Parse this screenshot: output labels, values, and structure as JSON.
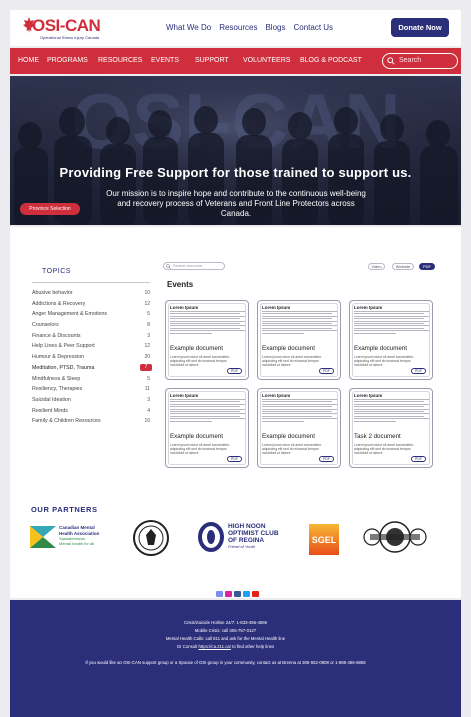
{
  "header": {
    "logo": {
      "word": "OSI-CAN",
      "tagline": "Operational Stress Injury Canada"
    },
    "topnav": [
      "What We Do",
      "Resources",
      "Blogs",
      "Contact Us"
    ],
    "donate": "Donate Now"
  },
  "mainnav": {
    "items": [
      "HOME",
      "PROGRAMS",
      "RESOURCES",
      "EVENTS",
      "SUPPORT",
      "VOLUNTEERS",
      "BLOG & PODCAST"
    ],
    "search_placeholder": "Search"
  },
  "hero": {
    "title": "Providing Free Support for those trained to support us.",
    "subtitle": "Our mission is to inspire hope and contribute to the continuous well-being and recovery process of Veterans and Front Line Protectors across Canada.",
    "province_button": "Province Selection",
    "backdrop_word": "OSI-CAN"
  },
  "topics": {
    "heading": "TOPICS",
    "items": [
      {
        "label": "Abusive behavior",
        "count": "10"
      },
      {
        "label": "Addictions & Recovery",
        "count": "12"
      },
      {
        "label": "Anger Management & Emotions",
        "count": "5"
      },
      {
        "label": "Counselors",
        "count": "8"
      },
      {
        "label": "Finance & Discounts",
        "count": "3"
      },
      {
        "label": "Help Lines & Peer Support",
        "count": "12"
      },
      {
        "label": "Humour & Depression",
        "count": "20"
      },
      {
        "label": "Meditation, PTSD, Trauma",
        "count": "7",
        "active": true
      },
      {
        "label": "Mindfulness & Sleep",
        "count": "5"
      },
      {
        "label": "Resiliency, Therapies",
        "count": "11"
      },
      {
        "label": "Suicidal Ideation",
        "count": "3"
      },
      {
        "label": "Resilient Minds",
        "count": "4"
      },
      {
        "label": "Family & Children Resources",
        "count": "16"
      }
    ]
  },
  "events": {
    "search_placeholder": "Search resource",
    "filters": [
      "Video",
      "Website",
      "PDF"
    ],
    "active_filter": "PDF",
    "heading": "Events",
    "cards": [
      {
        "heading": "Lorem Ipsum",
        "title": "Example document",
        "desc": "Lorem ipsum dolor sit amet consectetur adipiscing elit sed do eiusmod tempor incididunt ut labore",
        "tag": "PDF"
      },
      {
        "heading": "Lorem Ipsum",
        "title": "Example document",
        "desc": "Lorem ipsum dolor sit amet consectetur adipiscing elit sed do eiusmod tempor incididunt ut labore",
        "tag": "PDF"
      },
      {
        "heading": "Lorem Ipsum",
        "title": "Example document",
        "desc": "Lorem ipsum dolor sit amet consectetur adipiscing elit sed do eiusmod tempor incididunt ut labore",
        "tag": "PDF"
      },
      {
        "heading": "Lorem Ipsum",
        "title": "Example document",
        "desc": "Lorem ipsum dolor sit amet consectetur adipiscing elit sed do eiusmod tempor incididunt ut labore",
        "tag": "PDF"
      },
      {
        "heading": "Lorem Ipsum",
        "title": "Example document",
        "desc": "Lorem ipsum dolor sit amet consectetur adipiscing elit sed do eiusmod tempor incididunt ut labore",
        "tag": "PDF"
      },
      {
        "heading": "Lorem Ipsum",
        "title": "Task 2 document",
        "desc": "Lorem ipsum dolor sit amet consectetur adipiscing elit sed do eiusmod tempor incididunt ut labore",
        "tag": "PDF"
      }
    ]
  },
  "partners": {
    "heading": "OUR PARTNERS",
    "cmha": {
      "line1": "Canadian Mental",
      "line2": "Health Association",
      "line3": "Saskatchewan",
      "line4": "Mental health for all"
    },
    "optimist": {
      "line1": "HIGH NOON",
      "line2": "OPTIMIST CLUB",
      "line3": "OF REGINA",
      "line4": "Friend of Youth"
    },
    "sgel": "SGEL"
  },
  "footer": {
    "line1": "Crisis/Suicide Hotline 24/7: 1-833-456-4566",
    "line2": "Mobile Crisis: call 306-757-0127",
    "line3": "Mental Health Calls: call 811 and ask for the Mental Health line",
    "line4_prefix": "Or Consult ",
    "line4_link": "https://ca.211.ca/",
    "line4_suffix": " to find other help lines",
    "line5": "If you would like an OSI-CAN support group or a Spouse of OSI group in your community, contact us at Brenna at 306-552-0808 or 1-888-456-6868"
  },
  "colors": {
    "brand_red": "#cf2e3c",
    "brand_navy": "#2b2f7a"
  }
}
